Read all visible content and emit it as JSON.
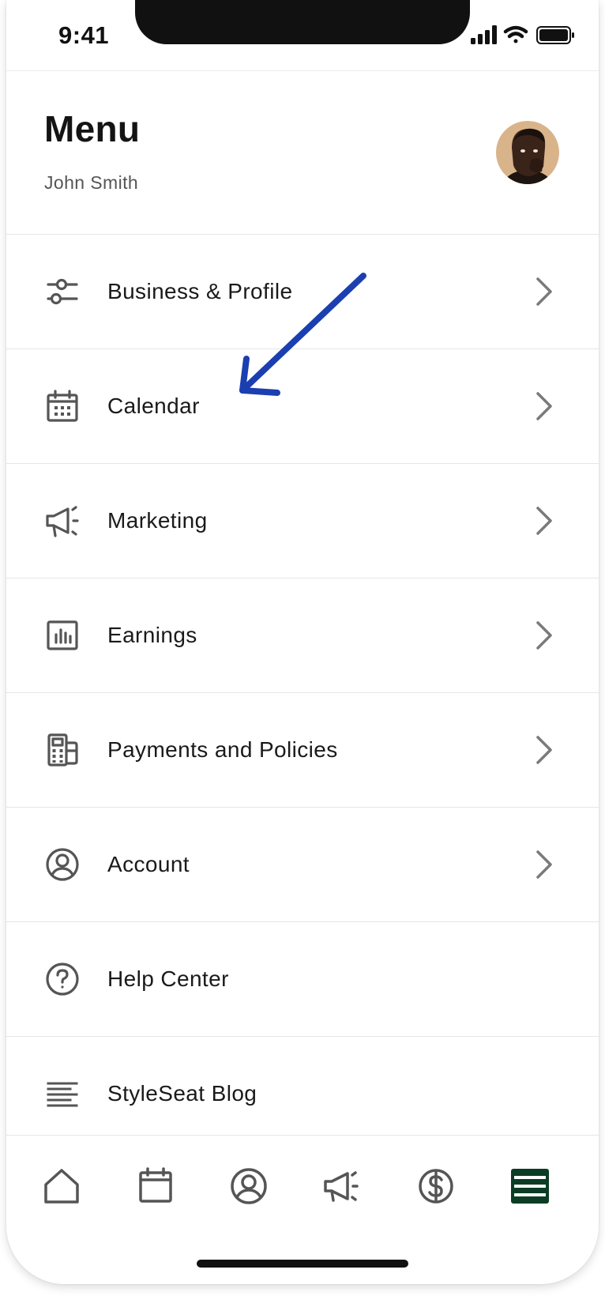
{
  "status_bar": {
    "time": "9:41"
  },
  "header": {
    "title": "Menu",
    "user_name": "John Smith"
  },
  "menu": {
    "items": [
      {
        "label": "Business & Profile",
        "icon": "sliders-icon",
        "has_chevron": true
      },
      {
        "label": "Calendar",
        "icon": "calendar-icon",
        "has_chevron": true
      },
      {
        "label": "Marketing",
        "icon": "megaphone-icon",
        "has_chevron": true
      },
      {
        "label": "Earnings",
        "icon": "bar-chart-icon",
        "has_chevron": true
      },
      {
        "label": "Payments and Policies",
        "icon": "payment-terminal-icon",
        "has_chevron": true
      },
      {
        "label": "Account",
        "icon": "user-circle-icon",
        "has_chevron": true
      },
      {
        "label": "Help Center",
        "icon": "question-circle-icon",
        "has_chevron": false
      },
      {
        "label": "StyleSeat Blog",
        "icon": "text-lines-icon",
        "has_chevron": false
      }
    ]
  },
  "tab_bar": {
    "tabs": [
      {
        "icon": "home-icon",
        "active": false
      },
      {
        "icon": "calendar-icon",
        "active": false
      },
      {
        "icon": "user-circle-icon",
        "active": false
      },
      {
        "icon": "megaphone-icon",
        "active": false
      },
      {
        "icon": "dollar-circle-icon",
        "active": false
      },
      {
        "icon": "menu-icon",
        "active": true
      }
    ]
  },
  "colors": {
    "icon_gray": "#555555",
    "chevron_gray": "#7a7a7a",
    "active_tab_green": "#0b3d24",
    "annotation_arrow_blue": "#1b3fb0"
  }
}
